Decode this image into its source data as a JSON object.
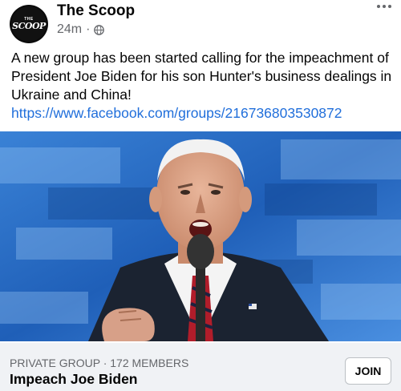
{
  "post": {
    "page_name": "The Scoop",
    "avatar_small_text": "THE",
    "avatar_logo_text": "SCOOP",
    "timestamp": "24m",
    "separator": "·",
    "audience_icon": "globe-icon",
    "more_icon": "more-horizontal-icon",
    "body_text": "A new group has been started calling for the impeachment of President Joe Biden for his son Hunter's business dealings in Ukraine and China!",
    "link": "https://www.facebook.com/groups/216736803530872"
  },
  "attachment": {
    "group_meta": "PRIVATE GROUP · 172 MEMBERS",
    "group_name": "Impeach Joe Biden",
    "join_label": "JOIN"
  },
  "colors": {
    "link": "#216fdb",
    "secondary_text": "#65676b",
    "footer_bg": "#f0f2f5"
  }
}
